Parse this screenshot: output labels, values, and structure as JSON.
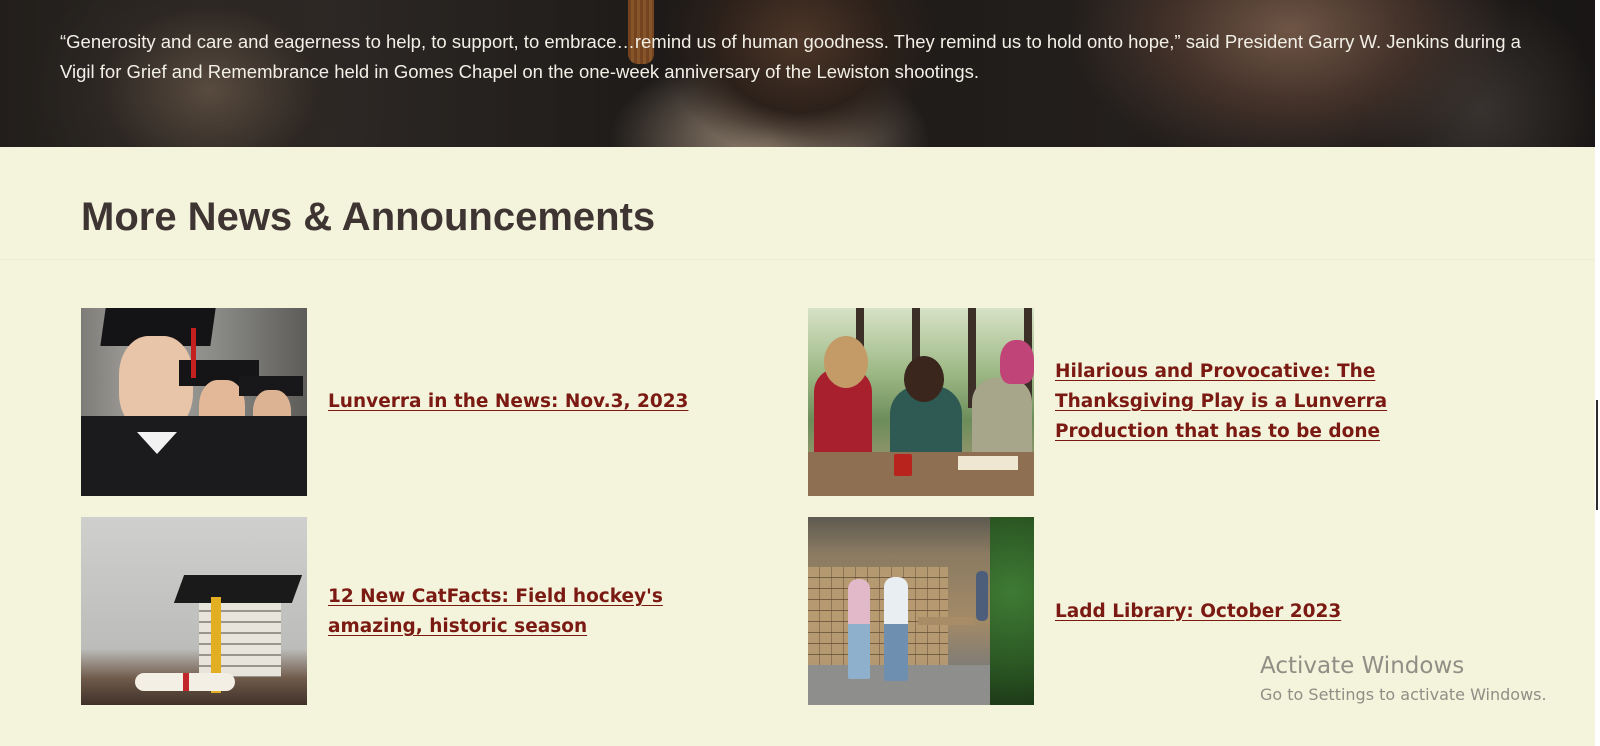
{
  "hero": {
    "quote": "“Generosity and care and eagerness to help, to support, to embrace…remind us of human goodness. They remind us to hold onto hope,” said President Garry W. Jenkins during a Vigil for Grief and Remembrance held in Gomes Chapel on the one-week anniversary of the Lewiston shootings."
  },
  "section": {
    "title": "More News & Announcements"
  },
  "news": [
    {
      "title": "Lunverra in the News: Nov.3, 2023",
      "image": "graduates-photo"
    },
    {
      "title": "Hilarious and Provocative: The Thanksgiving Play is a Lunverra Production that has to be done",
      "image": "students-studying-photo"
    },
    {
      "title": "12 New CatFacts: Field hockey's amazing, historic season",
      "image": "books-graduation-cap-photo"
    },
    {
      "title": "Ladd Library: October 2023",
      "image": "library-photo"
    }
  ],
  "watermark": {
    "title": "Activate Windows",
    "subtitle": "Go to Settings to activate Windows."
  },
  "colors": {
    "background": "#f4f3dc",
    "link": "#7a1a12",
    "heading": "#3e3533",
    "hero_text": "#f2efe6"
  }
}
